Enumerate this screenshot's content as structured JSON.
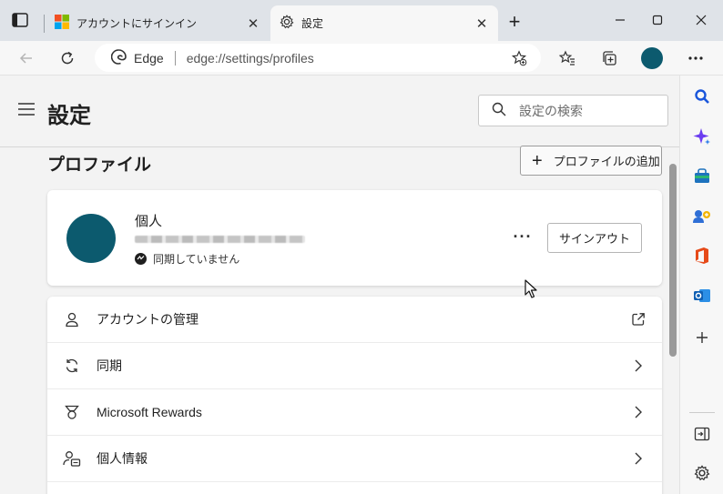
{
  "tabs": [
    {
      "title": "アカウントにサインイン",
      "icon": "microsoft-logo",
      "active": false
    },
    {
      "title": "設定",
      "icon": "gear-icon",
      "active": true
    }
  ],
  "window_controls": {
    "minimize": "minimize-icon",
    "maximize": "maximize-icon",
    "close": "close-icon"
  },
  "address_bar": {
    "identity": "Edge",
    "url": "edge://settings/profiles"
  },
  "settings": {
    "title": "設定",
    "search_placeholder": "設定の検索",
    "section_title": "プロファイル",
    "add_profile_label": "プロファイルの追加",
    "profile": {
      "name": "個人",
      "sync_status": "同期していません",
      "signout_label": "サインアウト",
      "more_label": "···"
    },
    "menu": [
      {
        "label": "アカウントの管理",
        "icon": "person-icon",
        "trail": "external-link-icon"
      },
      {
        "label": "同期",
        "icon": "sync-icon",
        "trail": "chevron-right-icon"
      },
      {
        "label": "Microsoft Rewards",
        "icon": "rewards-icon",
        "trail": "chevron-right-icon"
      },
      {
        "label": "個人情報",
        "icon": "personal-info-icon",
        "trail": "chevron-right-icon"
      }
    ]
  },
  "colors": {
    "avatar": "#0c5a6e",
    "tabstrip": "#dfe3e8",
    "accent_blue": "#0f6cbd"
  },
  "sidebar_icons": [
    "search-icon",
    "copilot-icon",
    "shopping-icon",
    "games-icon",
    "office-icon",
    "outlook-icon",
    "add-icon",
    "split-screen-icon",
    "settings-icon"
  ]
}
